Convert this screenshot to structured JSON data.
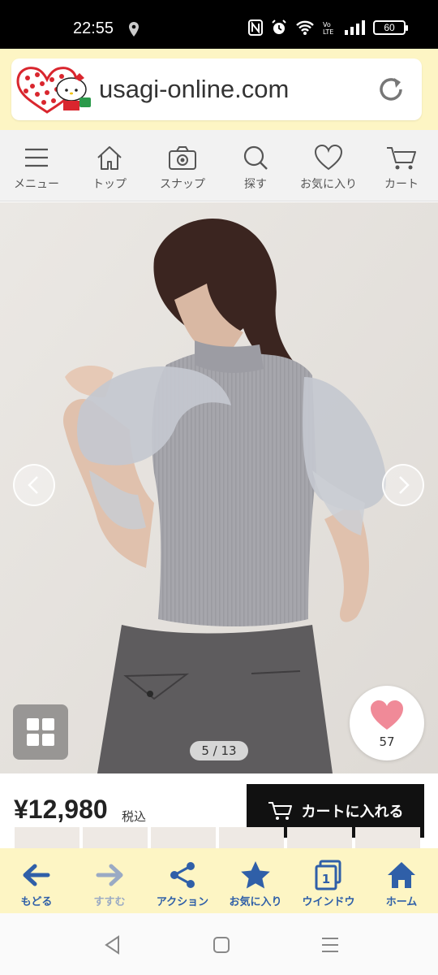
{
  "status_bar": {
    "time": "22:55",
    "battery": "60"
  },
  "address_bar": {
    "url": "usagi-online.com"
  },
  "site_nav": [
    {
      "label": "メニュー",
      "icon": "menu-icon"
    },
    {
      "label": "トップ",
      "icon": "home-icon"
    },
    {
      "label": "スナップ",
      "icon": "camera-icon"
    },
    {
      "label": "探す",
      "icon": "search-icon"
    },
    {
      "label": "お気に入り",
      "icon": "heart-icon"
    },
    {
      "label": "カート",
      "icon": "cart-icon"
    }
  ],
  "gallery": {
    "counter": "5 / 13",
    "favorite_count": "57"
  },
  "product": {
    "price": "¥12,980",
    "tax_label": "税込",
    "cart_button_label": "カートに入れる"
  },
  "browser_bar": [
    {
      "label": "もどる",
      "icon": "back-arrow-icon",
      "enabled": true
    },
    {
      "label": "すすむ",
      "icon": "forward-arrow-icon",
      "enabled": false
    },
    {
      "label": "アクション",
      "icon": "share-icon",
      "enabled": true
    },
    {
      "label": "お気に入り",
      "icon": "star-icon",
      "enabled": true
    },
    {
      "label": "ウインドウ",
      "icon": "windows-icon",
      "enabled": true,
      "badge": "1"
    },
    {
      "label": "ホーム",
      "icon": "home-icon",
      "enabled": true
    }
  ],
  "colors": {
    "accent": "#2f5fa8",
    "address_bar_bg": "#fdf5c4",
    "favorite_heart": "#f08a98"
  }
}
